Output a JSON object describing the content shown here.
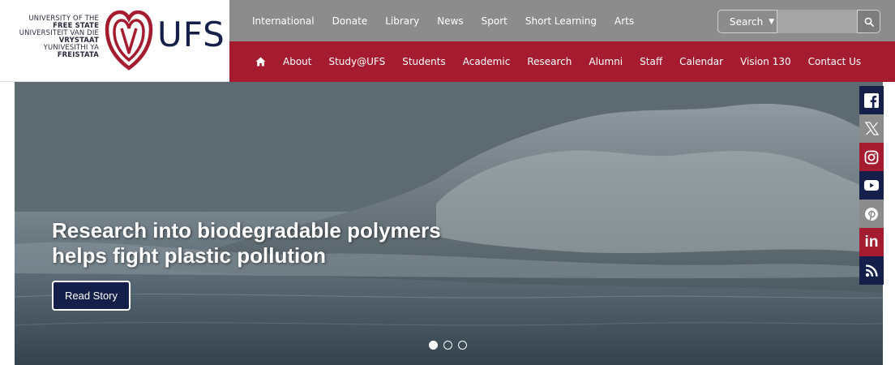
{
  "logo": {
    "lines": [
      {
        "text": "UNIVERSITY OF THE",
        "bold": false
      },
      {
        "text": "FREE STATE",
        "bold": true
      },
      {
        "text": "UNIVERSITEIT VAN DIE",
        "bold": false
      },
      {
        "text": "VRYSTAAT",
        "bold": true
      },
      {
        "text": "YUNIVESITHI YA",
        "bold": false
      },
      {
        "text": "FREISTATA",
        "bold": true
      }
    ],
    "wordmark": "UFS"
  },
  "topnav": [
    "International",
    "Donate",
    "Library",
    "News",
    "Sport",
    "Short Learning",
    "Arts"
  ],
  "search": {
    "dropdown_label": "Search",
    "placeholder": ""
  },
  "mainnav": [
    "About",
    "Study@UFS",
    "Students",
    "Academic",
    "Research",
    "Alumni",
    "Staff",
    "Calendar",
    "Vision 130",
    "Contact Us"
  ],
  "hero": {
    "headline_line1": "Research into biodegradable polymers",
    "headline_line2": "helps fight plastic pollution",
    "button": "Read Story",
    "slides": 3,
    "active_slide": 1
  },
  "social": [
    "facebook-icon",
    "x-icon",
    "instagram-icon",
    "youtube-icon",
    "pinterest-icon",
    "linkedin-icon",
    "rss-icon"
  ],
  "colors": {
    "navy": "#15204a",
    "red": "#a51c30",
    "grey": "#8c8c8c"
  }
}
